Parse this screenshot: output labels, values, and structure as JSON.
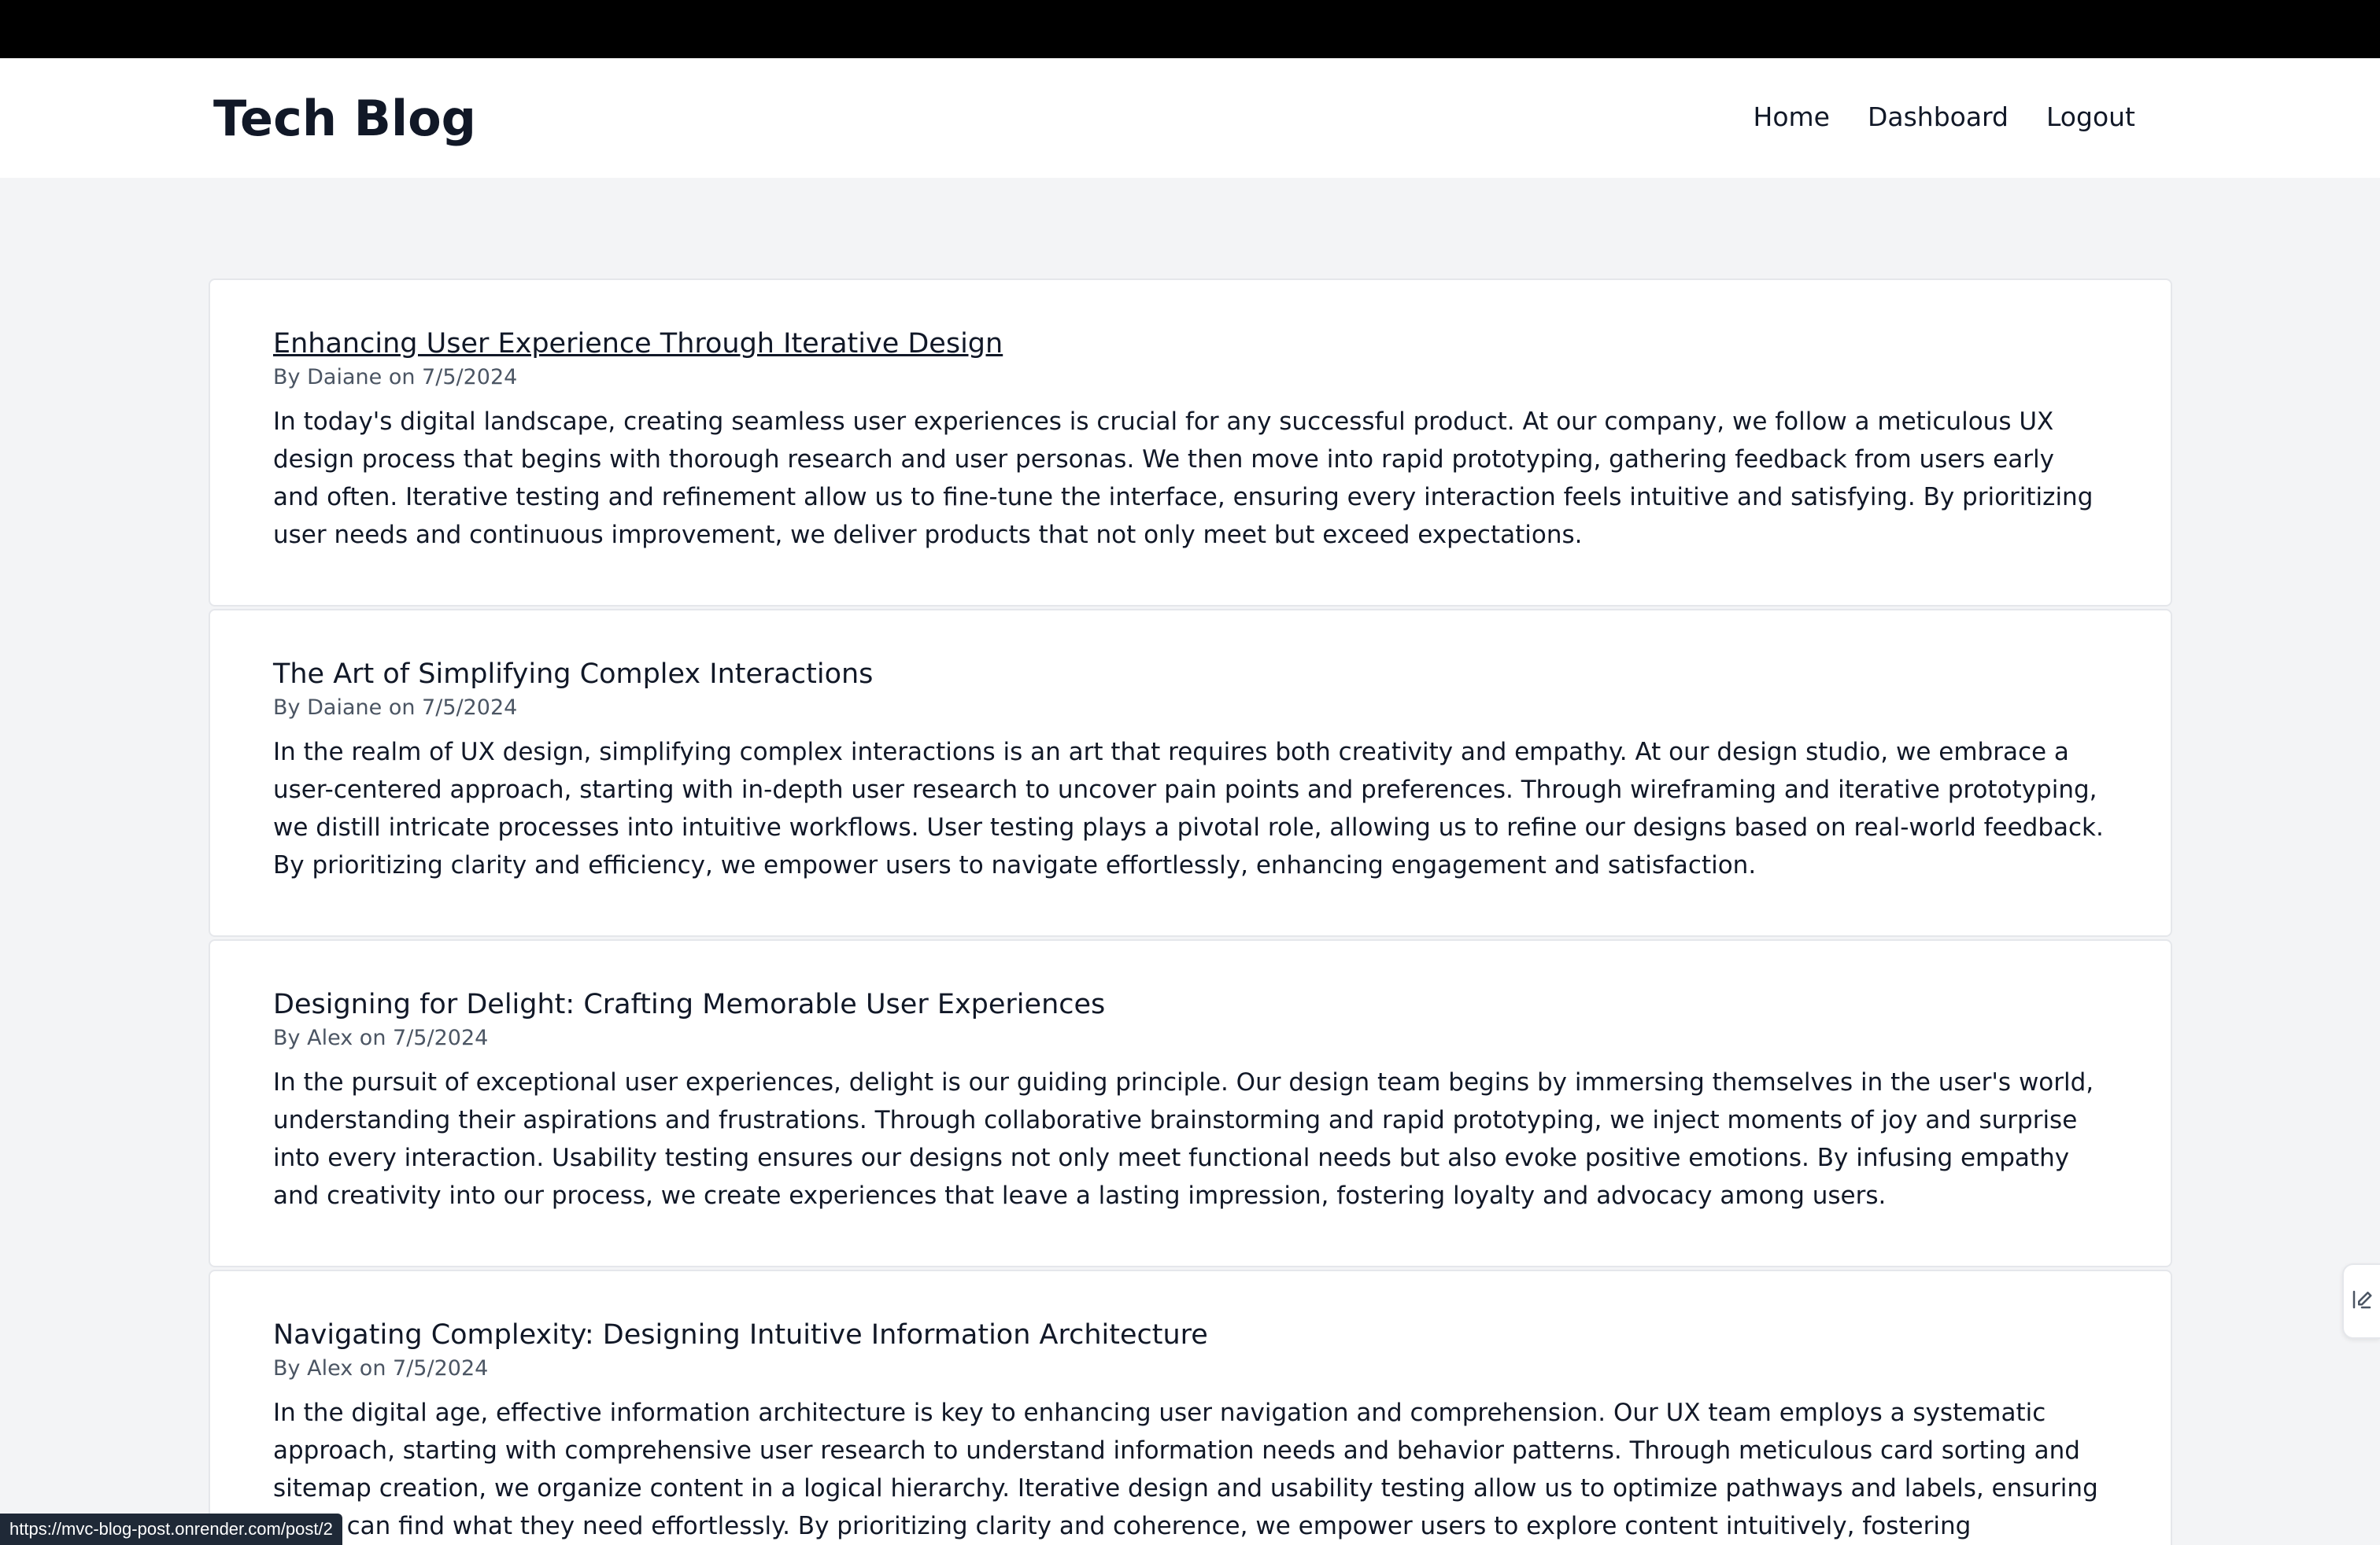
{
  "header": {
    "brand": "Tech Blog",
    "nav": [
      {
        "label": "Home"
      },
      {
        "label": "Dashboard"
      },
      {
        "label": "Logout"
      }
    ]
  },
  "posts": [
    {
      "title": "Enhancing User Experience Through Iterative Design",
      "by": "By",
      "author": "Daiane",
      "on": "on",
      "date": "7/5/2024",
      "body": "In today's digital landscape, creating seamless user experiences is crucial for any successful product. At our company, we follow a meticulous UX design process that begins with thorough research and user personas. We then move into rapid prototyping, gathering feedback from users early and often. Iterative testing and refinement allow us to fine-tune the interface, ensuring every interaction feels intuitive and satisfying. By prioritizing user needs and continuous improvement, we deliver products that not only meet but exceed expectations."
    },
    {
      "title": "The Art of Simplifying Complex Interactions",
      "by": "By",
      "author": "Daiane",
      "on": "on",
      "date": "7/5/2024",
      "body": "In the realm of UX design, simplifying complex interactions is an art that requires both creativity and empathy. At our design studio, we embrace a user-centered approach, starting with in-depth user research to uncover pain points and preferences. Through wireframing and iterative prototyping, we distill intricate processes into intuitive workflows. User testing plays a pivotal role, allowing us to refine our designs based on real-world feedback. By prioritizing clarity and efficiency, we empower users to navigate effortlessly, enhancing engagement and satisfaction."
    },
    {
      "title": "Designing for Delight: Crafting Memorable User Experiences",
      "by": "By",
      "author": "Alex",
      "on": "on",
      "date": "7/5/2024",
      "body": "In the pursuit of exceptional user experiences, delight is our guiding principle. Our design team begins by immersing themselves in the user's world, understanding their aspirations and frustrations. Through collaborative brainstorming and rapid prototyping, we inject moments of joy and surprise into every interaction. Usability testing ensures our designs not only meet functional needs but also evoke positive emotions. By infusing empathy and creativity into our process, we create experiences that leave a lasting impression, fostering loyalty and advocacy among users."
    },
    {
      "title": "Navigating Complexity: Designing Intuitive Information Architecture",
      "by": "By",
      "author": "Alex",
      "on": "on",
      "date": "7/5/2024",
      "body": "In the digital age, effective information architecture is key to enhancing user navigation and comprehension. Our UX team employs a systematic approach, starting with comprehensive user research to understand information needs and behavior patterns. Through meticulous card sorting and sitemap creation, we organize content in a logical hierarchy. Iterative design and usability testing allow us to optimize pathways and labels, ensuring users can find what they need effortlessly. By prioritizing clarity and coherence, we empower users to explore content intuitively, fostering engagement and trust."
    }
  ],
  "status_bar": {
    "url": "https://mvc-blog-post.onrender.com/post/2"
  },
  "side_handle": {
    "icon": "edit-icon"
  }
}
